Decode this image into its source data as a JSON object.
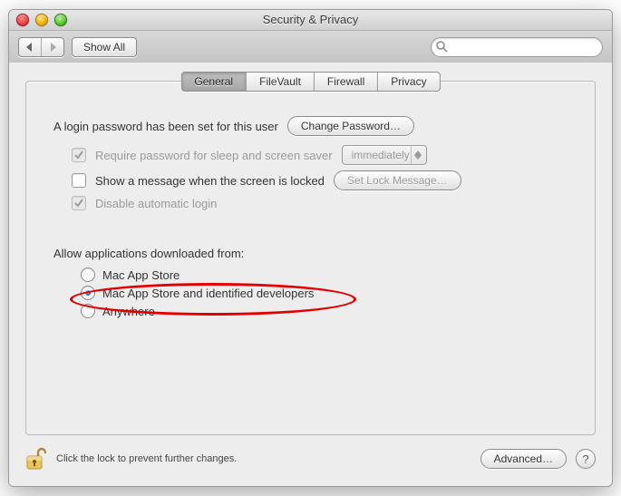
{
  "window": {
    "title": "Security & Privacy"
  },
  "toolbar": {
    "show_all_label": "Show All",
    "search_placeholder": ""
  },
  "tabs": [
    {
      "label": "General",
      "active": true
    },
    {
      "label": "FileVault",
      "active": false
    },
    {
      "label": "Firewall",
      "active": false
    },
    {
      "label": "Privacy",
      "active": false
    }
  ],
  "general": {
    "login_password_text": "A login password has been set for this user",
    "change_password_label": "Change Password…",
    "require_password_label": "Require password for sleep and screen saver",
    "require_password_delay": "immediately",
    "show_message_label": "Show a message when the screen is locked",
    "set_lock_message_label": "Set Lock Message…",
    "disable_auto_login_label": "Disable automatic login",
    "gatekeeper_heading": "Allow applications downloaded from:",
    "gatekeeper_options": [
      {
        "label": "Mac App Store",
        "selected": false
      },
      {
        "label": "Mac App Store and identified developers",
        "selected": true
      },
      {
        "label": "Anywhere",
        "selected": false
      }
    ]
  },
  "footer": {
    "lock_text": "Click the lock to prevent further changes.",
    "advanced_label": "Advanced…",
    "help_label": "?"
  }
}
